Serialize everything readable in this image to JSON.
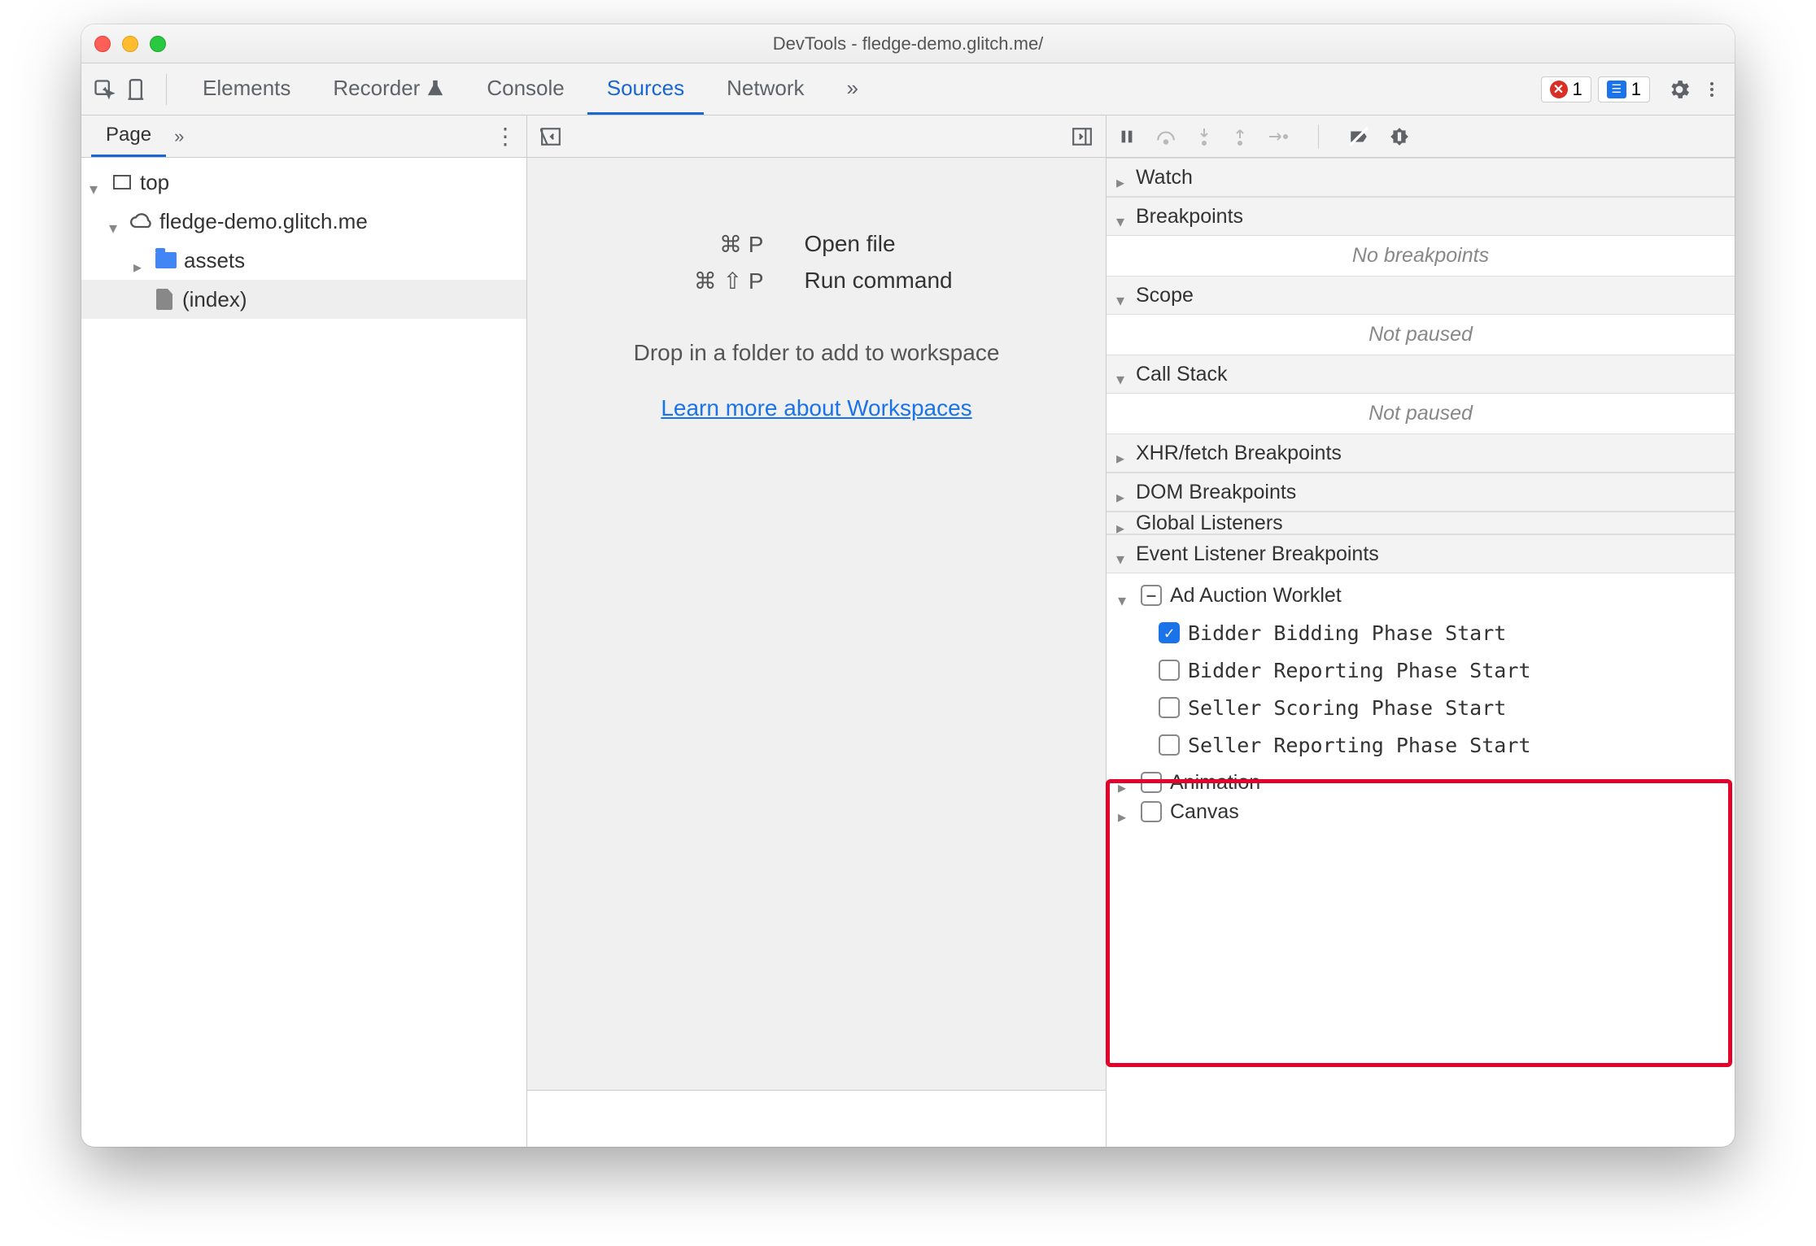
{
  "window": {
    "title": "DevTools - fledge-demo.glitch.me/"
  },
  "toolbar": {
    "tabs": [
      "Elements",
      "Recorder",
      "Console",
      "Sources",
      "Network"
    ],
    "activeTab": "Sources",
    "more": "»",
    "errorCount": "1",
    "messageCount": "1"
  },
  "navigator": {
    "tab": "Page",
    "more": "»",
    "tree": {
      "top": "top",
      "origin": "fledge-demo.glitch.me",
      "folder": "assets",
      "file": "(index)"
    }
  },
  "editor": {
    "shortcuts": {
      "openFileKey": "⌘ P",
      "openFileLabel": "Open file",
      "runCmdKey": "⌘ ⇧ P",
      "runCmdLabel": "Run command"
    },
    "drop": "Drop in a folder to add to workspace",
    "link": "Learn more about Workspaces"
  },
  "debugger": {
    "sections": {
      "watch": "Watch",
      "breakpoints": "Breakpoints",
      "breakpointsEmpty": "No breakpoints",
      "scope": "Scope",
      "scopeEmpty": "Not paused",
      "callstack": "Call Stack",
      "callstackEmpty": "Not paused",
      "xhr": "XHR/fetch Breakpoints",
      "dom": "DOM Breakpoints",
      "global": "Global Listeners",
      "elb": "Event Listener Breakpoints",
      "animation": "Animation",
      "canvas": "Canvas"
    },
    "adAuction": {
      "label": "Ad Auction Worklet",
      "items": [
        {
          "label": "Bidder Bidding Phase Start",
          "checked": true
        },
        {
          "label": "Bidder Reporting Phase Start",
          "checked": false
        },
        {
          "label": "Seller Scoring Phase Start",
          "checked": false
        },
        {
          "label": "Seller Reporting Phase Start",
          "checked": false
        }
      ]
    }
  }
}
